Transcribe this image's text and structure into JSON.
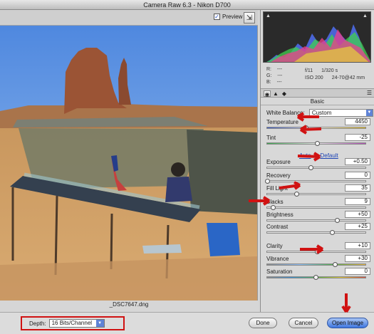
{
  "window": {
    "title": "Camera Raw 6.3  -  Nikon D700"
  },
  "toolbar": {
    "preview_label": "Preview",
    "preview_checked": "✓"
  },
  "image": {
    "filename": "_DSC7647.dng"
  },
  "histogram": {
    "readout": {
      "r_label": "R:",
      "r_value": "---",
      "g_label": "G:",
      "g_value": "---",
      "b_label": "B:",
      "b_value": "---",
      "aperture": "f/11",
      "shutter": "1/320 s",
      "iso": "ISO 200",
      "lens": "24-70@42 mm"
    }
  },
  "panel": {
    "section_title": "Basic",
    "white_balance_label": "White Balance:",
    "white_balance_value": "Custom",
    "auto_label": "Auto",
    "default_label": "Default",
    "sliders": [
      {
        "label": "Temperature",
        "value": "4450"
      },
      {
        "label": "Tint",
        "value": "-25"
      },
      {
        "label": "Exposure",
        "value": "+0.50"
      },
      {
        "label": "Recovery",
        "value": "0"
      },
      {
        "label": "Fill Light",
        "value": "35"
      },
      {
        "label": "Blacks",
        "value": "9"
      },
      {
        "label": "Brightness",
        "value": "+50"
      },
      {
        "label": "Contrast",
        "value": "+25"
      },
      {
        "label": "Clarity",
        "value": "+10"
      },
      {
        "label": "Vibrance",
        "value": "+30"
      },
      {
        "label": "Saturation",
        "value": "0"
      }
    ]
  },
  "bottom": {
    "depth_label": "Depth:",
    "depth_value": "16 Bits/Channel",
    "done_label": "Done",
    "cancel_label": "Cancel",
    "open_image_label": "Open Image"
  },
  "colors": {
    "annotation_red": "#d01212",
    "primary_button": "#3e76df"
  }
}
